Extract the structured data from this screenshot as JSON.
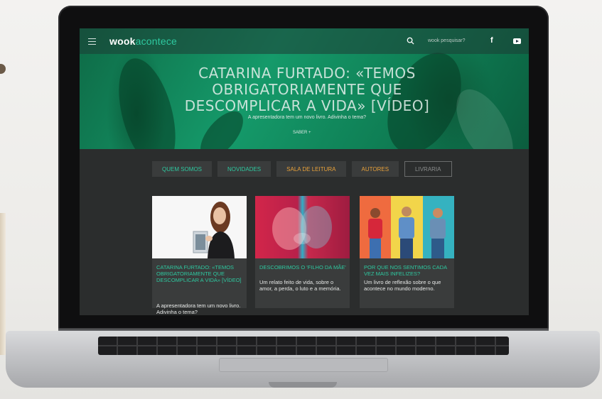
{
  "site": {
    "logo_bold": "wook",
    "logo_light": "acontece",
    "search_placeholder": "wook pesquisar?",
    "facebook_label": "f"
  },
  "hero": {
    "title": "CATARINA FURTADO: «TEMOS OBRIGATORIAMENTE QUE DESCOMPLICAR A VIDA» [VÍDEO]",
    "subtitle": "A apresentadora tem um novo livro. Adivinha o tema?",
    "link": "SABER +"
  },
  "nav": [
    {
      "label": "QUEM SOMOS",
      "color": "#2ec9a0"
    },
    {
      "label": "NOVIDADES",
      "color": "#2ec9a0"
    },
    {
      "label": "SALA DE LEITURA",
      "color": "#e8a13a"
    },
    {
      "label": "AUTORES",
      "color": "#e8a13a"
    },
    {
      "label": "LIVRARIA",
      "color": "#8b8d8d"
    }
  ],
  "cards": [
    {
      "title": "CATARINA FURTADO: «TEMOS OBRIGATORIAMENTE QUE DESCOMPLICAR A VIDA» [VÍDEO]",
      "desc": "A apresentadora tem um novo livro. Adivinha o tema?"
    },
    {
      "title": "DESCOBRIMOS O 'FILHO DA MÃE'",
      "desc": "Um relato feito de vida, sobre o amor, a perda, o luto e a memória."
    },
    {
      "title": "POR QUE NOS SENTIMOS CADA VEZ MAIS INFELIZES?",
      "desc": "Um livro de reflexão sobre o que acontece no mundo moderno."
    }
  ],
  "colors": {
    "accent_teal": "#2ec9a0",
    "accent_orange": "#e8a13a",
    "page_bg": "#2b2d2d"
  }
}
